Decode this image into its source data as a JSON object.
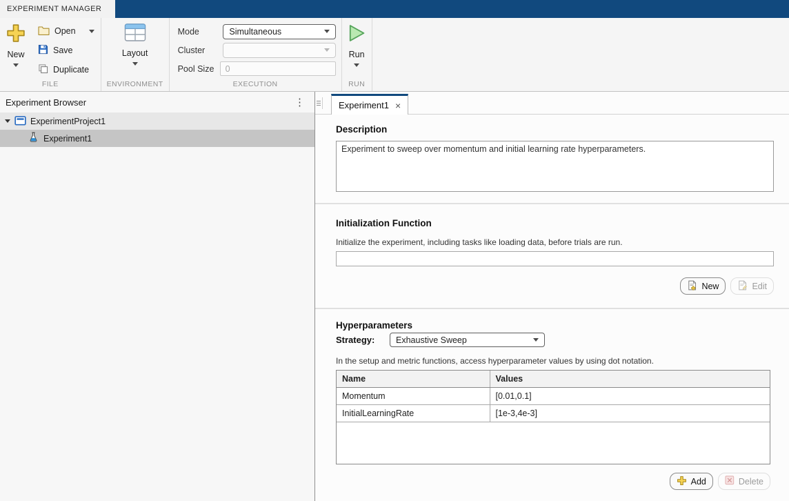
{
  "app": {
    "ribbon_tab": "EXPERIMENT MANAGER"
  },
  "colors": {
    "accent_navy": "#11497e",
    "selection_gray": "#c5c5c5",
    "run_green": "#b9e9b1",
    "plus_yellow": "#f6d354"
  },
  "icons": {
    "close": "×",
    "menu_dots": "⋮"
  },
  "toolbar": {
    "file": {
      "label": "FILE",
      "new_label": "New",
      "open_label": "Open",
      "save_label": "Save",
      "duplicate_label": "Duplicate"
    },
    "environment": {
      "label": "ENVIRONMENT",
      "layout_label": "Layout"
    },
    "execution": {
      "label": "EXECUTION",
      "mode_label": "Mode",
      "mode_value": "Simultaneous",
      "cluster_label": "Cluster",
      "cluster_value": "",
      "pool_size_label": "Pool Size",
      "pool_size_value": "0"
    },
    "run": {
      "label": "RUN",
      "run_label": "Run"
    }
  },
  "browser": {
    "title": "Experiment Browser",
    "project": "ExperimentProject1",
    "experiment": "Experiment1"
  },
  "document": {
    "tab_label": "Experiment1",
    "description": {
      "heading": "Description",
      "value": "Experiment to sweep over momentum and initial learning rate hyperparameters."
    },
    "init_function": {
      "heading": "Initialization Function",
      "hint": "Initialize the experiment, including tasks like loading data, before trials are run.",
      "value": "",
      "new_label": "New",
      "edit_label": "Edit"
    },
    "hyperparameters": {
      "heading": "Hyperparameters",
      "strategy_label": "Strategy:",
      "strategy_value": "Exhaustive Sweep",
      "hint": "In the setup and metric functions, access hyperparameter values by using dot notation.",
      "table": {
        "columns": [
          "Name",
          "Values"
        ],
        "rows": [
          {
            "name": "Momentum",
            "values": "[0.01,0.1]"
          },
          {
            "name": "InitialLearningRate",
            "values": "[1e-3,4e-3]"
          }
        ]
      },
      "add_label": "Add",
      "delete_label": "Delete"
    }
  }
}
